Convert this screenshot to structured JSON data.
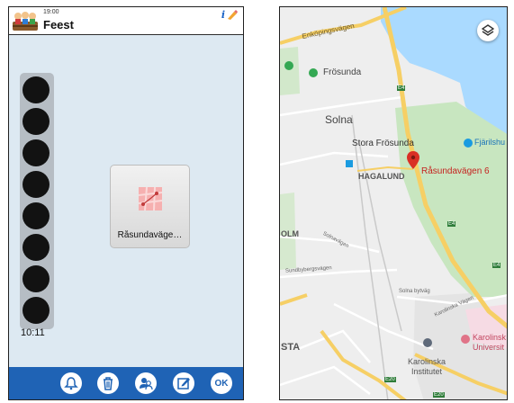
{
  "header": {
    "time": "19:00",
    "title": "Feest",
    "info_glyph": "i"
  },
  "schedule": {
    "dot_count": 8,
    "time_label": "10:11"
  },
  "activity_tile": {
    "label": "Råsundaväge…",
    "icon": "map-icon"
  },
  "toolbar": {
    "ok_label": "OK",
    "buttons": [
      "bell-icon",
      "trash-icon",
      "people-icon",
      "edit-icon",
      "ok-button"
    ]
  },
  "map": {
    "labels": {
      "enkoping": "Enköpingsvägen",
      "frosunda": "Frösunda",
      "solna": "Solna",
      "stora_frosunda": "Stora Frösunda",
      "hagalund": "HAGALUND",
      "fjarilshus": "Fjärilshu",
      "pin": "Råsundavägen 6",
      "olm": "OLM",
      "solnavagen": "Solnavägen",
      "sundbyberg": "Sundbybergsvägen",
      "solna_bytesvag": "Solna bytväg",
      "karolinska_vag": "Karolinska Vägen",
      "karolinska_inst_1": "Karolinska",
      "karolinska_inst_2": "Institutet",
      "karolinska_univ_1": "Karolinsk",
      "karolinska_univ_2": "Universit",
      "sta": "STA",
      "e4_a": "E4",
      "e4_b": "E4",
      "e4_c": "E4",
      "e20": "E20",
      "e20_b": "E20"
    },
    "colors": {
      "water": "#aadaff",
      "park": "#c8e6c0",
      "road_major": "#f6cf65",
      "land": "#eeeeee",
      "pin": "#d93025"
    }
  }
}
